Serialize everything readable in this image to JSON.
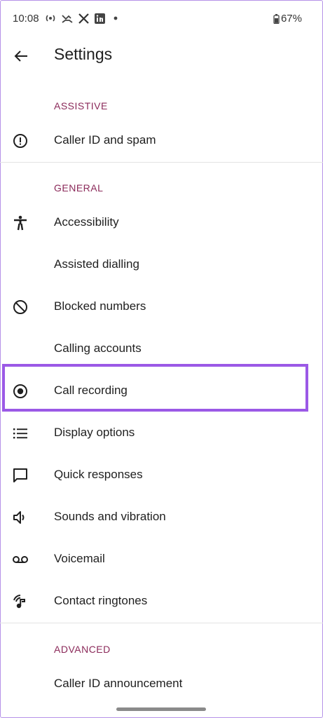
{
  "status_bar": {
    "time": "10:08",
    "icons": [
      "hotspot-icon",
      "missed-call-icon",
      "x-logo-icon",
      "linkedin-logo-icon",
      "notification-dot-icon"
    ],
    "battery": "67%"
  },
  "app_bar": {
    "title": "Settings"
  },
  "sections": {
    "assistive": "ASSISTIVE",
    "general": "GENERAL",
    "advanced": "ADVANCED"
  },
  "items": [
    {
      "label": "Caller ID and spam",
      "icon": "alert-circle-icon"
    },
    {
      "label": "Accessibility",
      "icon": "accessibility-icon"
    },
    {
      "label": "Assisted dialling",
      "icon": ""
    },
    {
      "label": "Blocked numbers",
      "icon": "block-icon"
    },
    {
      "label": "Calling accounts",
      "icon": ""
    },
    {
      "label": "Call recording",
      "icon": "record-icon"
    },
    {
      "label": "Display options",
      "icon": "list-icon"
    },
    {
      "label": "Quick responses",
      "icon": "message-icon"
    },
    {
      "label": "Sounds and vibration",
      "icon": "volume-icon"
    },
    {
      "label": "Voicemail",
      "icon": "voicemail-icon"
    },
    {
      "label": "Contact ringtones",
      "icon": "ringtone-icon"
    },
    {
      "label": "Caller ID announcement",
      "icon": ""
    }
  ],
  "colors": {
    "section_header": "#8b2a5a",
    "highlight_border": "#9b59e6",
    "text": "#1f1f1f",
    "divider": "#e3e3e3"
  }
}
